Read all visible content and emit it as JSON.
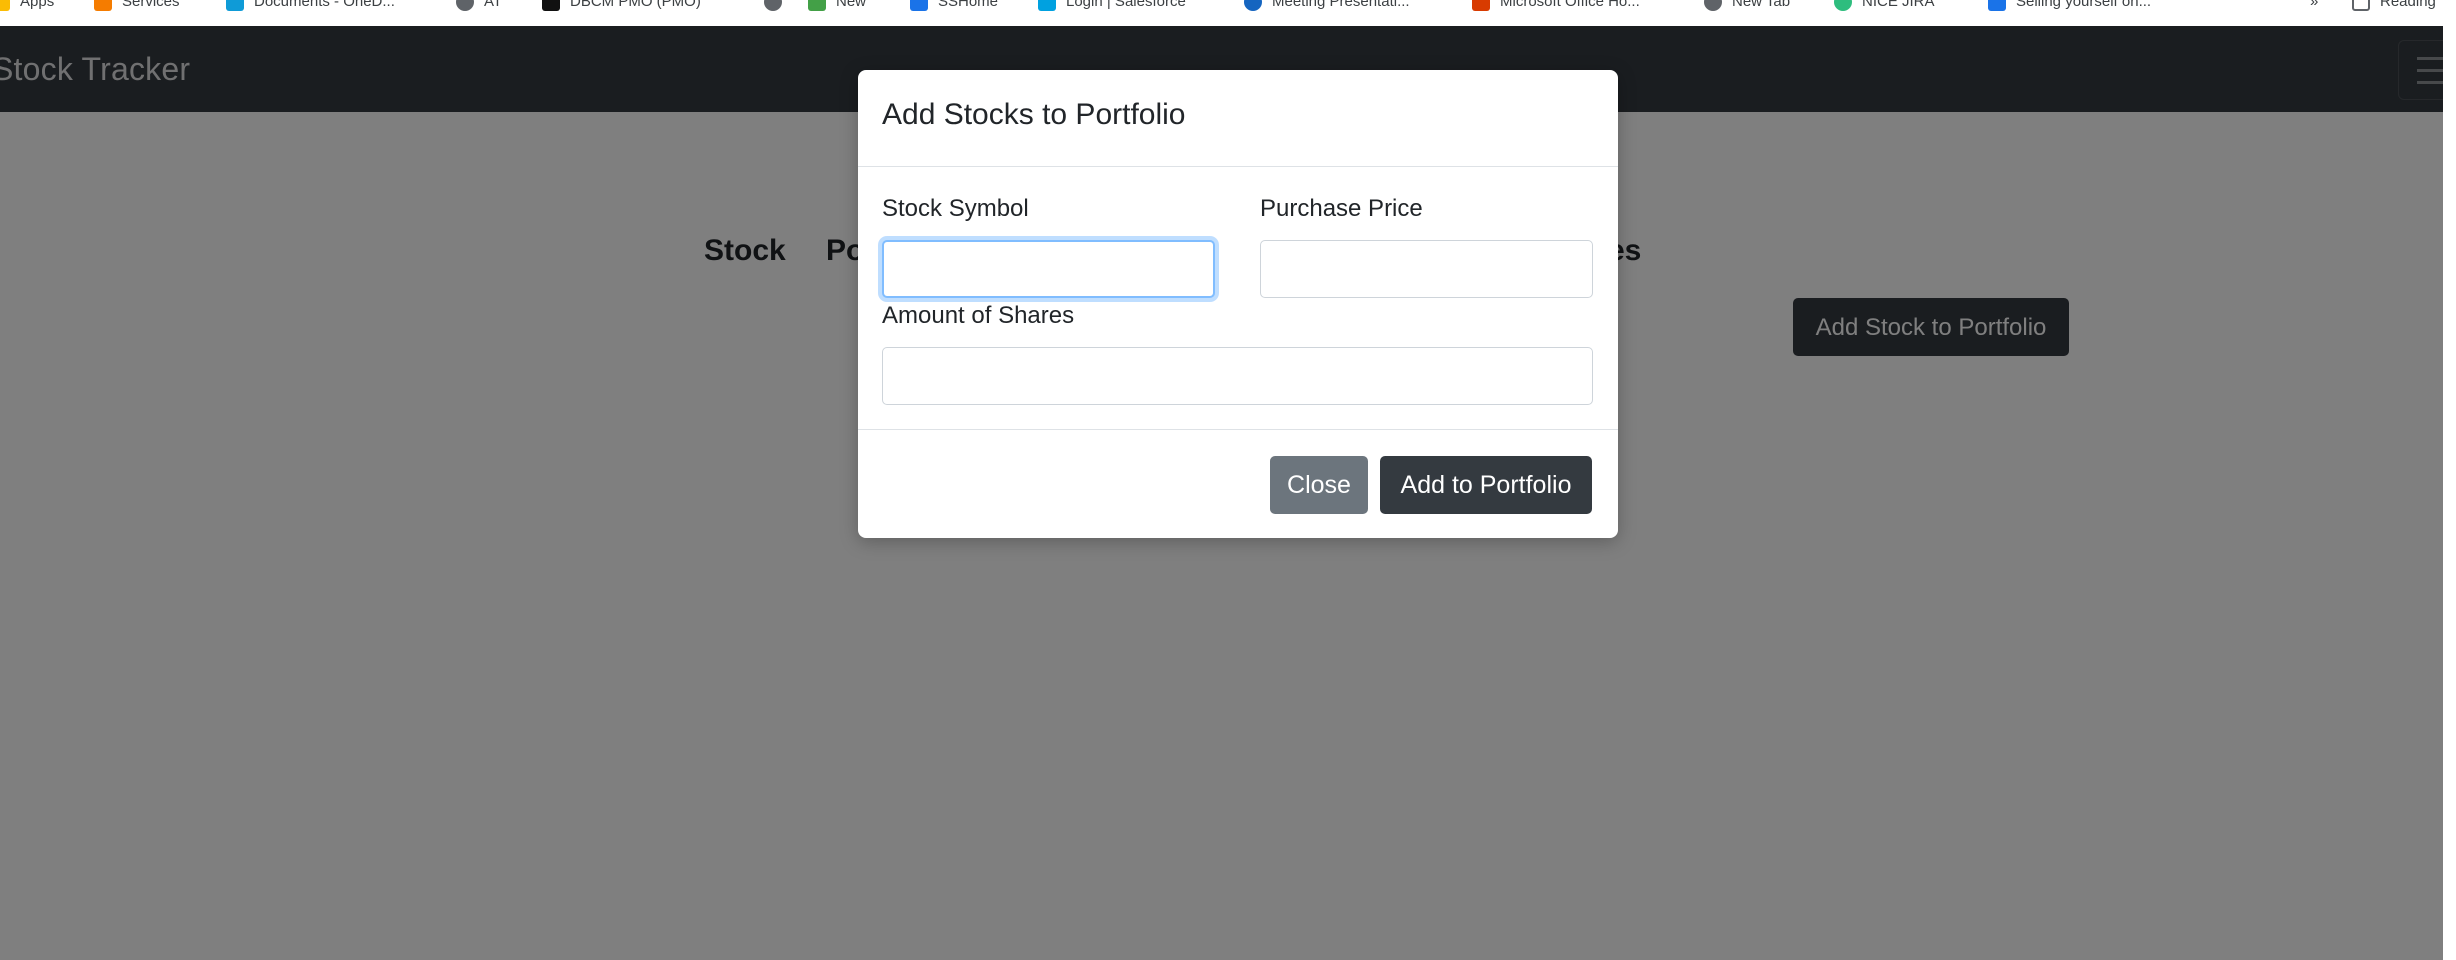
{
  "bookmarks": [
    {
      "label": "Apps",
      "icon": "apps-grid-icon",
      "color": "#fbbc04"
    },
    {
      "label": "Services",
      "icon": "services-icon",
      "color": "#f57c00"
    },
    {
      "label": "Documents - OneD...",
      "icon": "onedrive-folder-icon",
      "color": "#0f9bd7"
    },
    {
      "label": "AT",
      "icon": "globe-icon",
      "color": "#5f6368"
    },
    {
      "label": "DBCM PMO (PMO)",
      "icon": "k-logo-icon",
      "color": "#111111"
    },
    {
      "label": "",
      "icon": "globe-icon",
      "color": "#5f6368"
    },
    {
      "label": "New",
      "icon": "arrow-icon",
      "color": "#43a047"
    },
    {
      "label": "SSHome",
      "icon": "chart-icon",
      "color": "#1a73e8"
    },
    {
      "label": "Login | Salesforce",
      "icon": "salesforce-icon",
      "color": "#00a1e0"
    },
    {
      "label": "Meeting Presentati...",
      "icon": "meeting-icon",
      "color": "#1565c0"
    },
    {
      "label": "Microsoft Office Ho...",
      "icon": "office-icon",
      "color": "#d83b01"
    },
    {
      "label": "New Tab",
      "icon": "globe-icon",
      "color": "#5f6368"
    },
    {
      "label": "NICE JIRA",
      "icon": "jira-icon",
      "color": "#2ebd7e"
    },
    {
      "label": "Selling yourself on...",
      "icon": "chart-icon",
      "color": "#1a73e8"
    },
    {
      "label": "»",
      "icon": "",
      "color": ""
    },
    {
      "label": "Reading",
      "icon": "reading-list-icon",
      "color": "#5f6368"
    }
  ],
  "app": {
    "brand": "Stock Tracker",
    "toggler_icon": "hamburger-menu-icon",
    "table_headers_visible": [
      "Stock",
      "Po",
      "es"
    ],
    "add_button_label": "Add Stock to Portfolio"
  },
  "modal": {
    "title": "Add Stocks to Portfolio",
    "fields": {
      "stock_symbol": {
        "label": "Stock Symbol",
        "value": ""
      },
      "purchase_price": {
        "label": "Purchase Price",
        "value": ""
      },
      "amount_of_shares": {
        "label": "Amount of Shares",
        "value": ""
      }
    },
    "close_label": "Close",
    "submit_label": "Add to Portfolio"
  },
  "colors": {
    "navbar": "#343a40",
    "backdrop": "rgba(0,0,0,0.5)",
    "secondary_button": "#6c757d",
    "dark_button": "#343a40",
    "focus_ring": "#80bdff"
  }
}
